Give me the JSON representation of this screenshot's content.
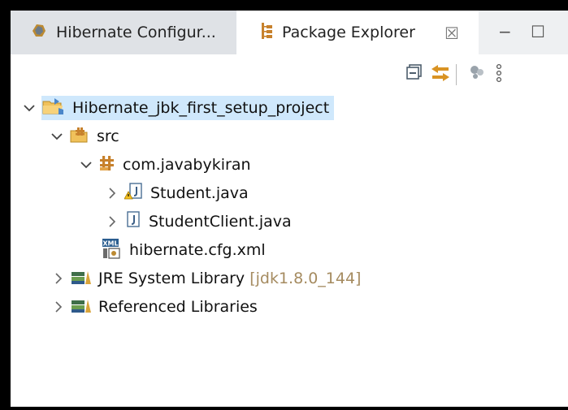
{
  "tabs": [
    {
      "label": "Hibernate Configur...",
      "icon": "hibernate-icon"
    },
    {
      "label": "Package Explorer",
      "icon": "package-explorer-icon",
      "close": "☒"
    }
  ],
  "window_buttons": {
    "minimize": "−",
    "maximize": "☐"
  },
  "toolbar": {
    "items": [
      "collapse-all-icon",
      "link-with-editor-icon",
      "view-menu-icon",
      "kebab-icon"
    ]
  },
  "tree": {
    "project": {
      "label": "Hibernate_jbk_first_setup_project"
    },
    "src": {
      "label": "src"
    },
    "package": {
      "label": "com.javabykiran"
    },
    "files": [
      {
        "label": "Student.java"
      },
      {
        "label": "StudentClient.java"
      }
    ],
    "config": {
      "label": "hibernate.cfg.xml"
    },
    "jre": {
      "label": "JRE System Library",
      "suffix": "[jdk1.8.0_144]"
    },
    "libs": {
      "label": "Referenced Libraries"
    }
  },
  "colors": {
    "accent": "#cfe8fc",
    "muted": "#a58b60"
  }
}
